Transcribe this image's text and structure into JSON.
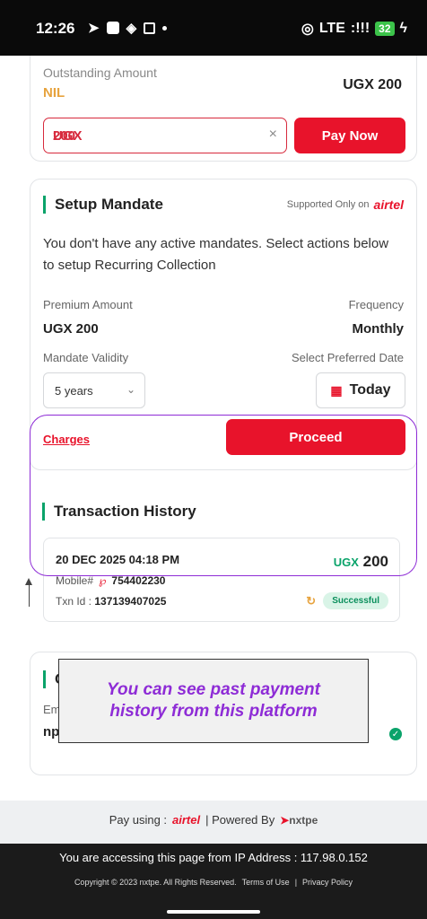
{
  "status_bar": {
    "time": "12:26",
    "network": "LTE",
    "signal": ":!!!",
    "battery": "32"
  },
  "outstanding": {
    "label": "Outstanding Amount",
    "status": "NIL",
    "amount": "UGX 200",
    "input_currency": "UGX",
    "input_value": "200",
    "clear_icon": "×",
    "pay_button": "Pay Now"
  },
  "mandate": {
    "title": "Setup Mandate",
    "supported_text": "Supported Only on",
    "provider": "airtel",
    "description": "You don't have any active mandates. Select actions below to setup Recurring Collection",
    "premium_label": "Premium Amount",
    "premium_value": "UGX 200",
    "frequency_label": "Frequency",
    "frequency_value": "Monthly",
    "validity_label": "Mandate Validity",
    "validity_value": "5 years",
    "date_label": "Select Preferred Date",
    "date_value": "Today",
    "charges_link": "Charges",
    "proceed_button": "Proceed"
  },
  "transaction": {
    "title": "Transaction History",
    "date": "20 DEC 2025 04:18 PM",
    "mobile_label": "Mobile#",
    "mobile_number": "754402230",
    "txn_label": "Txn Id :",
    "txn_id": "137139407025",
    "currency": "UGX",
    "amount": "200",
    "status": "Successful"
  },
  "contact": {
    "title_initial": "C",
    "email_label": "Em",
    "email_value": "np"
  },
  "annotation": {
    "line1": "You can see past payment",
    "line2": "history from this platform"
  },
  "pay_using": {
    "label": "Pay using :",
    "provider": "airtel",
    "powered_by": "| Powered By",
    "brand": "nxtpe"
  },
  "footer": {
    "ip_text": "You are accessing this page from IP Address : 117.98.0.152",
    "copyright": "Copyright © 2023 nxtpe. All Rights Reserved.",
    "terms": "Terms of Use",
    "separator": "|",
    "privacy": "Privacy Policy"
  },
  "colors": {
    "accent_red": "#e8132b",
    "accent_green": "#0aa36a",
    "highlight_purple": "#8e2cd6",
    "nil_orange": "#e7a33e"
  }
}
